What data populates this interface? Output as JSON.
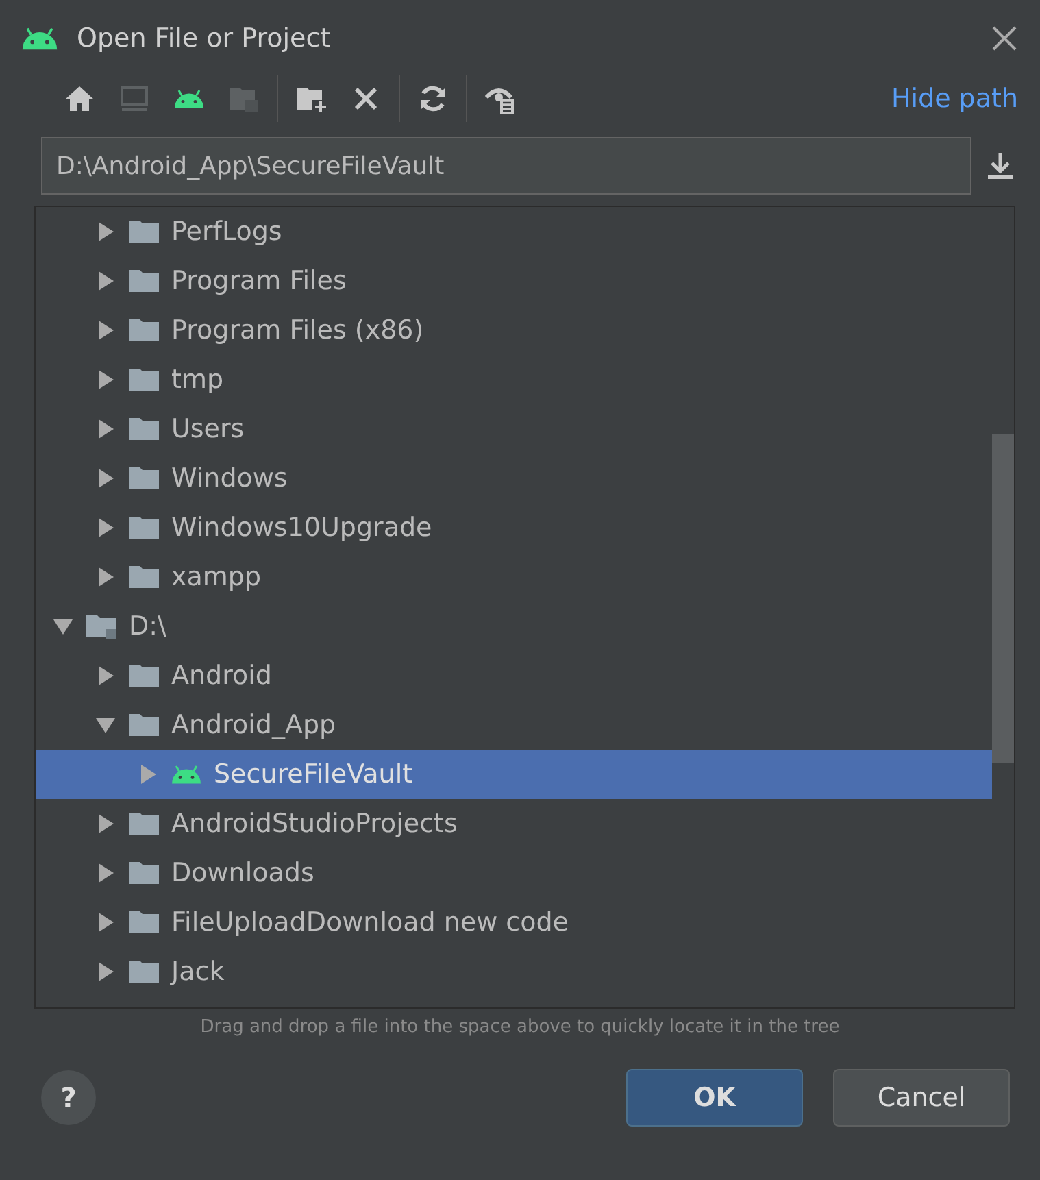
{
  "window": {
    "title": "Open File or Project"
  },
  "toolbar": {
    "link": "Hide path"
  },
  "path_field": {
    "value": "D:\\Android_App\\SecureFileVault"
  },
  "tree": {
    "rows_above": [
      {
        "label": "PerfLogs",
        "kind": "folder",
        "expanded": false,
        "selected": false
      },
      {
        "label": "Program Files",
        "kind": "folder",
        "expanded": false,
        "selected": false
      },
      {
        "label": "Program Files (x86)",
        "kind": "folder",
        "expanded": false,
        "selected": false
      },
      {
        "label": "tmp",
        "kind": "folder",
        "expanded": false,
        "selected": false
      },
      {
        "label": "Users",
        "kind": "folder",
        "expanded": false,
        "selected": false
      },
      {
        "label": "Windows",
        "kind": "folder",
        "expanded": false,
        "selected": false
      },
      {
        "label": "Windows10Upgrade",
        "kind": "folder",
        "expanded": false,
        "selected": false
      },
      {
        "label": "xampp",
        "kind": "folder",
        "expanded": false,
        "selected": false
      }
    ],
    "roots": [
      {
        "label": "D:\\",
        "kind": "drive",
        "expanded": true,
        "selected": false,
        "children": [
          {
            "label": "Android",
            "kind": "folder",
            "expanded": false,
            "selected": false
          },
          {
            "label": "Android_App",
            "kind": "folder",
            "expanded": true,
            "selected": false,
            "children": [
              {
                "label": "SecureFileVault",
                "kind": "android",
                "expanded": false,
                "selected": true
              }
            ]
          },
          {
            "label": "AndroidStudioProjects",
            "kind": "folder",
            "expanded": false,
            "selected": false
          },
          {
            "label": "Downloads",
            "kind": "folder",
            "expanded": false,
            "selected": false
          },
          {
            "label": "FileUploadDownload new code",
            "kind": "folder",
            "expanded": false,
            "selected": false
          },
          {
            "label": "Jack",
            "kind": "folder",
            "expanded": false,
            "selected": false
          }
        ]
      }
    ]
  },
  "hint": "Drag and drop a file into the space above to quickly locate it in the tree",
  "help_button": "?",
  "buttons": [
    {
      "label": "OK",
      "kind": "primary"
    },
    {
      "label": "Cancel",
      "kind": "secondary"
    }
  ]
}
